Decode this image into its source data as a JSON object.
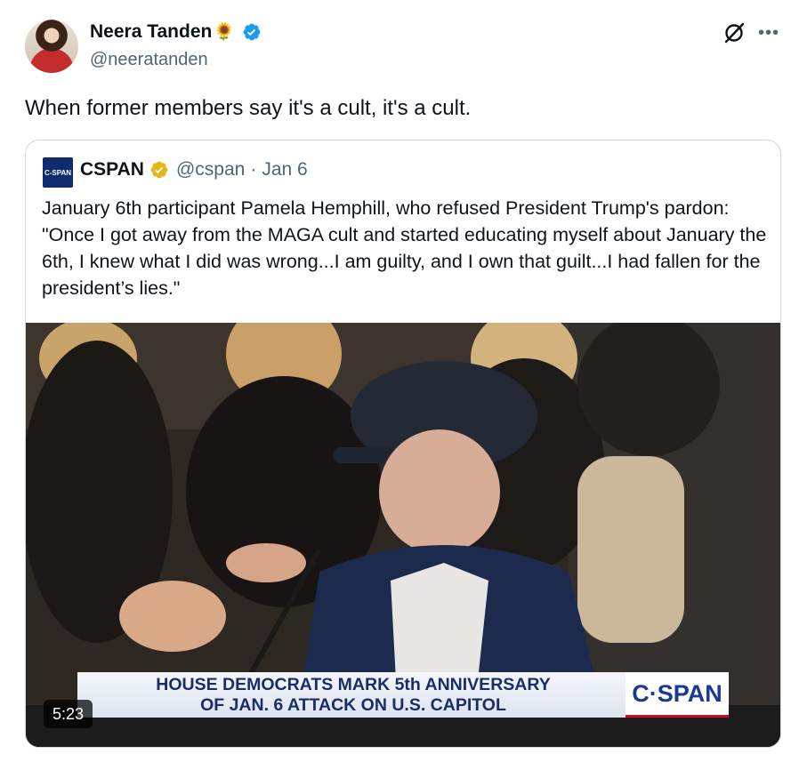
{
  "tweet": {
    "author_name": "Neera Tanden",
    "author_emoji": "🌻",
    "author_handle": "@neeratanden",
    "text": "When former members say it's a cult, it's a cult."
  },
  "quoted": {
    "logo_text": "C-SPAN",
    "author_name": "CSPAN",
    "author_handle": "@cspan",
    "separator": "·",
    "date": "Jan 6",
    "text": "January 6th participant Pamela Hemphill, who refused President Trump's pardon: \"Once I got away from the MAGA cult and started educating myself about January the 6th, I knew what I did was wrong...I am guilty, and I own that guilt...I had fallen for the president’s lies.\"",
    "video": {
      "banner_line1": "HOUSE DEMOCRATS MARK 5th ANNIVERSARY",
      "banner_line2": "OF JAN. 6 ATTACK ON U.S. CAPITOL",
      "banner_logo": "C·SPAN",
      "duration": "5:23"
    }
  },
  "icons": {
    "grok": "grok-icon",
    "more": "more-icon",
    "verified": "verified-badge-icon",
    "gold_verified": "gold-verified-badge-icon"
  },
  "colors": {
    "blue_check": "#1d9bf0",
    "gold_check": "#e2b719",
    "cspan_navy": "#1a2d6b",
    "secondary_text": "#536471"
  }
}
